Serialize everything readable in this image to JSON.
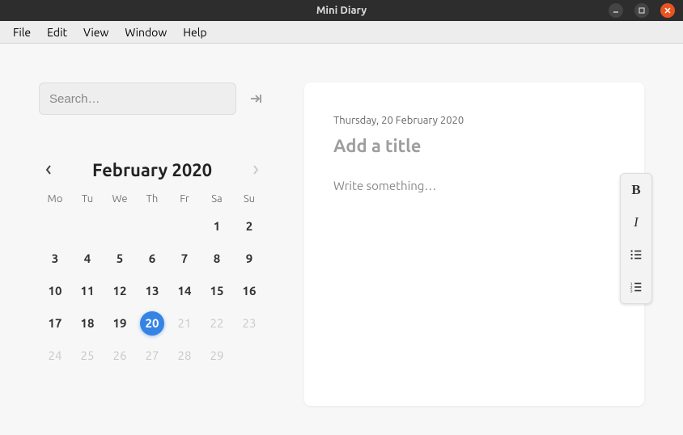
{
  "window": {
    "title": "Mini Diary"
  },
  "menubar": {
    "items": [
      "File",
      "Edit",
      "View",
      "Window",
      "Help"
    ]
  },
  "search": {
    "placeholder": "Search…"
  },
  "calendar": {
    "title": "February 2020",
    "dow": [
      "Mo",
      "Tu",
      "We",
      "Th",
      "Fr",
      "Sa",
      "Su"
    ],
    "first_weekday_index": 5,
    "days_in_month": 29,
    "selected": 20,
    "disabled_from": 21
  },
  "entry": {
    "date": "Thursday, 20 February 2020",
    "title_placeholder": "Add a title",
    "body_placeholder": "Write something…"
  },
  "format": {
    "bold_label": "B",
    "italic_label": "I"
  }
}
